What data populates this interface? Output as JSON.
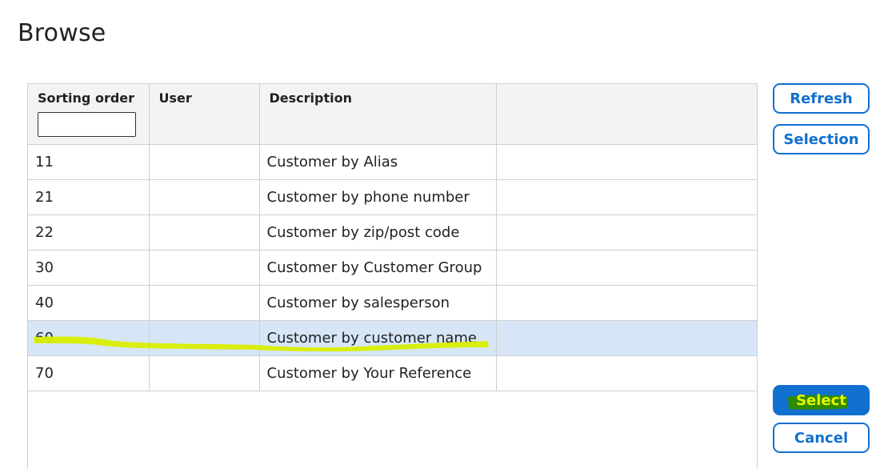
{
  "page": {
    "title": "Browse"
  },
  "grid": {
    "columns": [
      {
        "label": "Sorting order",
        "has_filter": true
      },
      {
        "label": "User"
      },
      {
        "label": "Description"
      },
      {
        "label": ""
      }
    ],
    "filter": {
      "value": "",
      "placeholder": ""
    },
    "rows": [
      {
        "order": "11",
        "user": "",
        "description": "Customer by Alias",
        "selected": false
      },
      {
        "order": "21",
        "user": "",
        "description": "Customer by phone number",
        "selected": false
      },
      {
        "order": "22",
        "user": "",
        "description": "Customer by zip/post code",
        "selected": false
      },
      {
        "order": "30",
        "user": "",
        "description": "Customer by Customer Group",
        "selected": false
      },
      {
        "order": "40",
        "user": "",
        "description": "Customer by salesperson",
        "selected": false
      },
      {
        "order": "60",
        "user": "",
        "description": "Customer by customer name",
        "selected": true
      },
      {
        "order": "70",
        "user": "",
        "description": "Customer by Your Reference",
        "selected": false
      }
    ]
  },
  "buttons": {
    "refresh": "Refresh",
    "selection": "Selection",
    "select": "Select",
    "cancel": "Cancel"
  },
  "colors": {
    "accent": "#1170cf",
    "selected_row": "#d6e6f7",
    "highlighter_yellow": "#d9ee00",
    "highlighter_green": "#2e8b00"
  }
}
